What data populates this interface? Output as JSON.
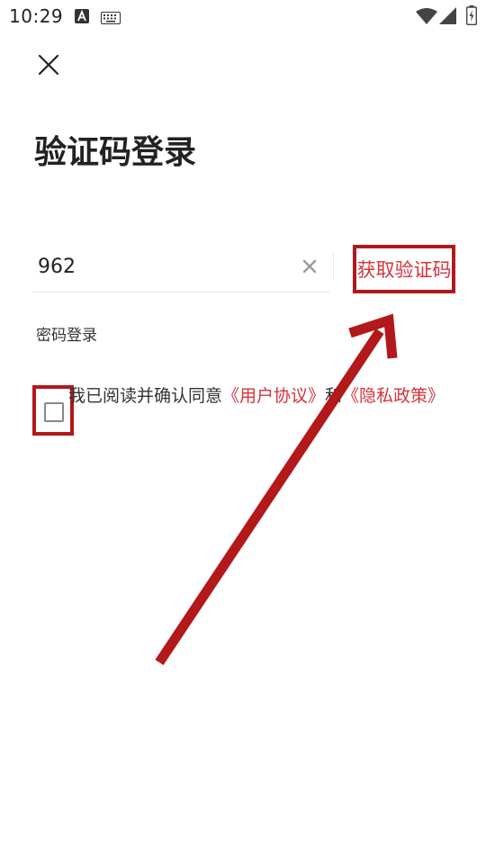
{
  "status_bar": {
    "time": "10:29",
    "icons": [
      "text-a-icon",
      "keyboard-icon",
      "wifi-icon",
      "signal-icon",
      "battery-icon"
    ]
  },
  "header": {
    "close_icon": "close-icon",
    "title": "验证码登录"
  },
  "form": {
    "phone_value": "962",
    "clear_icon": "clear-icon",
    "get_code_label": "获取验证码",
    "password_login_label": "密码登录"
  },
  "agreement": {
    "checked": false,
    "prefix": "我已阅读并确认同意",
    "user_agreement": "《用户协议》",
    "conjunction": "和",
    "privacy_policy": "《隐私政策》"
  },
  "annotation": {
    "highlight_color": "#b3181a",
    "arrow_color": "#b3181a",
    "link_color": "#d4333b"
  }
}
